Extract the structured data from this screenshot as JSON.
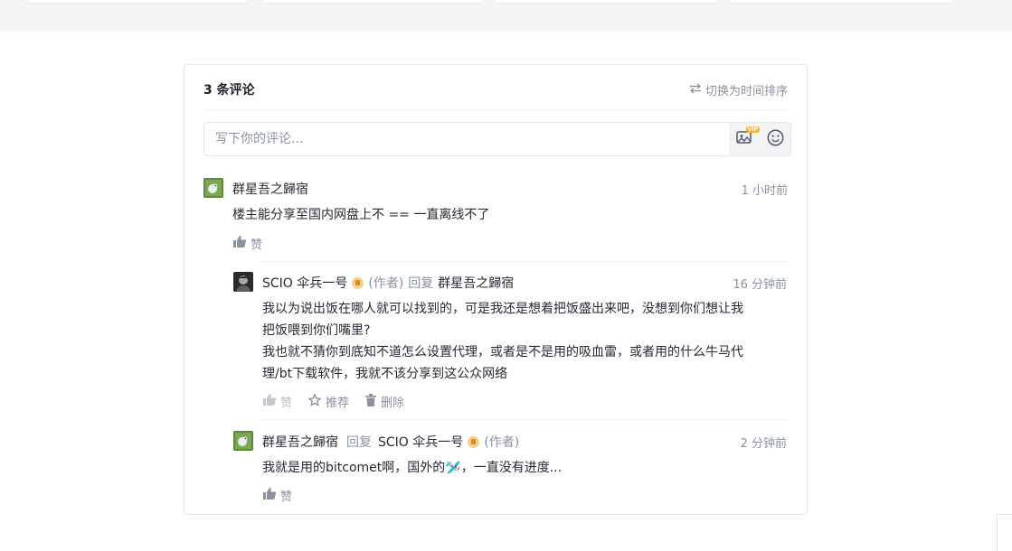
{
  "comments_header": {
    "count_label": "3 条评论",
    "sort_label": "切换为时间排序"
  },
  "editor": {
    "placeholder": "写下你的评论...",
    "vip_badge": "VIP"
  },
  "comments": [
    {
      "user": "群星吾之歸宿",
      "time": "1 小时前",
      "content": "楼主能分享至国内网盘上不 == 一直离线不了",
      "like_label": "赞"
    }
  ],
  "replies": [
    {
      "user": "SCIO 伞兵一号",
      "author_tag": "(作者)",
      "reply_word": "回复",
      "reply_to": "群星吾之歸宿",
      "time": "16 分钟前",
      "content_lines": [
        "我以为说出饭在哪人就可以找到的，可是我还是想着把饭盛出来吧，没想到你们想让我",
        "把饭喂到你们嘴里?",
        "我也就不猜你到底知不道怎么设置代理，或者是不是用的吸血雷，或者用的什么牛马代",
        "理/bt下载软件，我就不该分享到这公众网络"
      ],
      "like_label": "赞",
      "recommend_label": "推荐",
      "delete_label": "删除"
    },
    {
      "user": "群星吾之歸宿",
      "reply_word": "回复",
      "reply_to": "SCIO 伞兵一号",
      "reply_to_tag": "(作者)",
      "time": "2 分钟前",
      "content": "我就是用的bitcomet啊，国外的🛩️，一直没有进度...",
      "like_label": "赞"
    }
  ],
  "colors": {
    "text": "#252933",
    "muted": "#8a919f",
    "border": "#e4e6eb",
    "avatar_green": "#5a8a3a"
  }
}
